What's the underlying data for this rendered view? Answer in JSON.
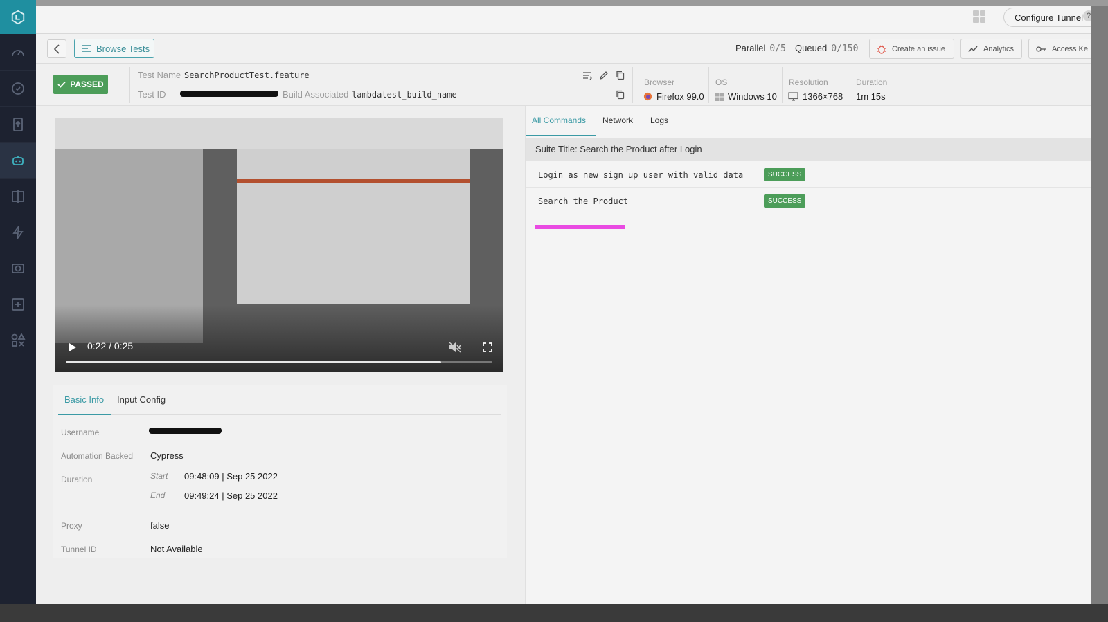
{
  "topbar": {
    "configure_tunnel": "Configure Tunnel",
    "help": "?"
  },
  "toolbar": {
    "browse_tests": "Browse Tests",
    "parallel_label": "Parallel",
    "parallel_value": "0/5",
    "queued_label": "Queued",
    "queued_value": "0/150",
    "create_issue": "Create an issue",
    "analytics": "Analytics",
    "access_key": "Access Ke"
  },
  "test": {
    "status": "PASSED",
    "name_label": "Test Name",
    "name": "SearchProductTest.feature",
    "id_label": "Test ID",
    "build_label": "Build Associated",
    "build": "lambdatest_build_name"
  },
  "meta": {
    "browser_label": "Browser",
    "browser": "Firefox 99.0",
    "os_label": "OS",
    "os": "Windows 10",
    "resolution_label": "Resolution",
    "resolution": "1366×768",
    "duration_label": "Duration",
    "duration": "1m 15s"
  },
  "video": {
    "time": "0:22 / 0:25",
    "progress": 0.88
  },
  "basic_info": {
    "tabs": [
      "Basic Info",
      "Input Config"
    ],
    "username_label": "Username",
    "automation_label": "Automation Backed",
    "automation": "Cypress",
    "duration_label": "Duration",
    "start_label": "Start",
    "start": "09:48:09 | Sep 25 2022",
    "end_label": "End",
    "end": "09:49:24 | Sep 25 2022",
    "proxy_label": "Proxy",
    "proxy": "false",
    "tunnel_label": "Tunnel ID",
    "tunnel": "Not Available"
  },
  "commands": {
    "tabs": [
      "All Commands",
      "Network",
      "Logs"
    ],
    "suite_title": "Suite Title: Search the Product after Login",
    "rows": [
      {
        "text": "Login as new sign up user with valid data",
        "status": "SUCCESS"
      },
      {
        "text": "Search the Product",
        "status": "SUCCESS"
      }
    ]
  },
  "colors": {
    "accent": "#3b9aa5",
    "success": "#4c9d59",
    "highlight": "#e94be2",
    "sidebar": "#1d2230"
  }
}
